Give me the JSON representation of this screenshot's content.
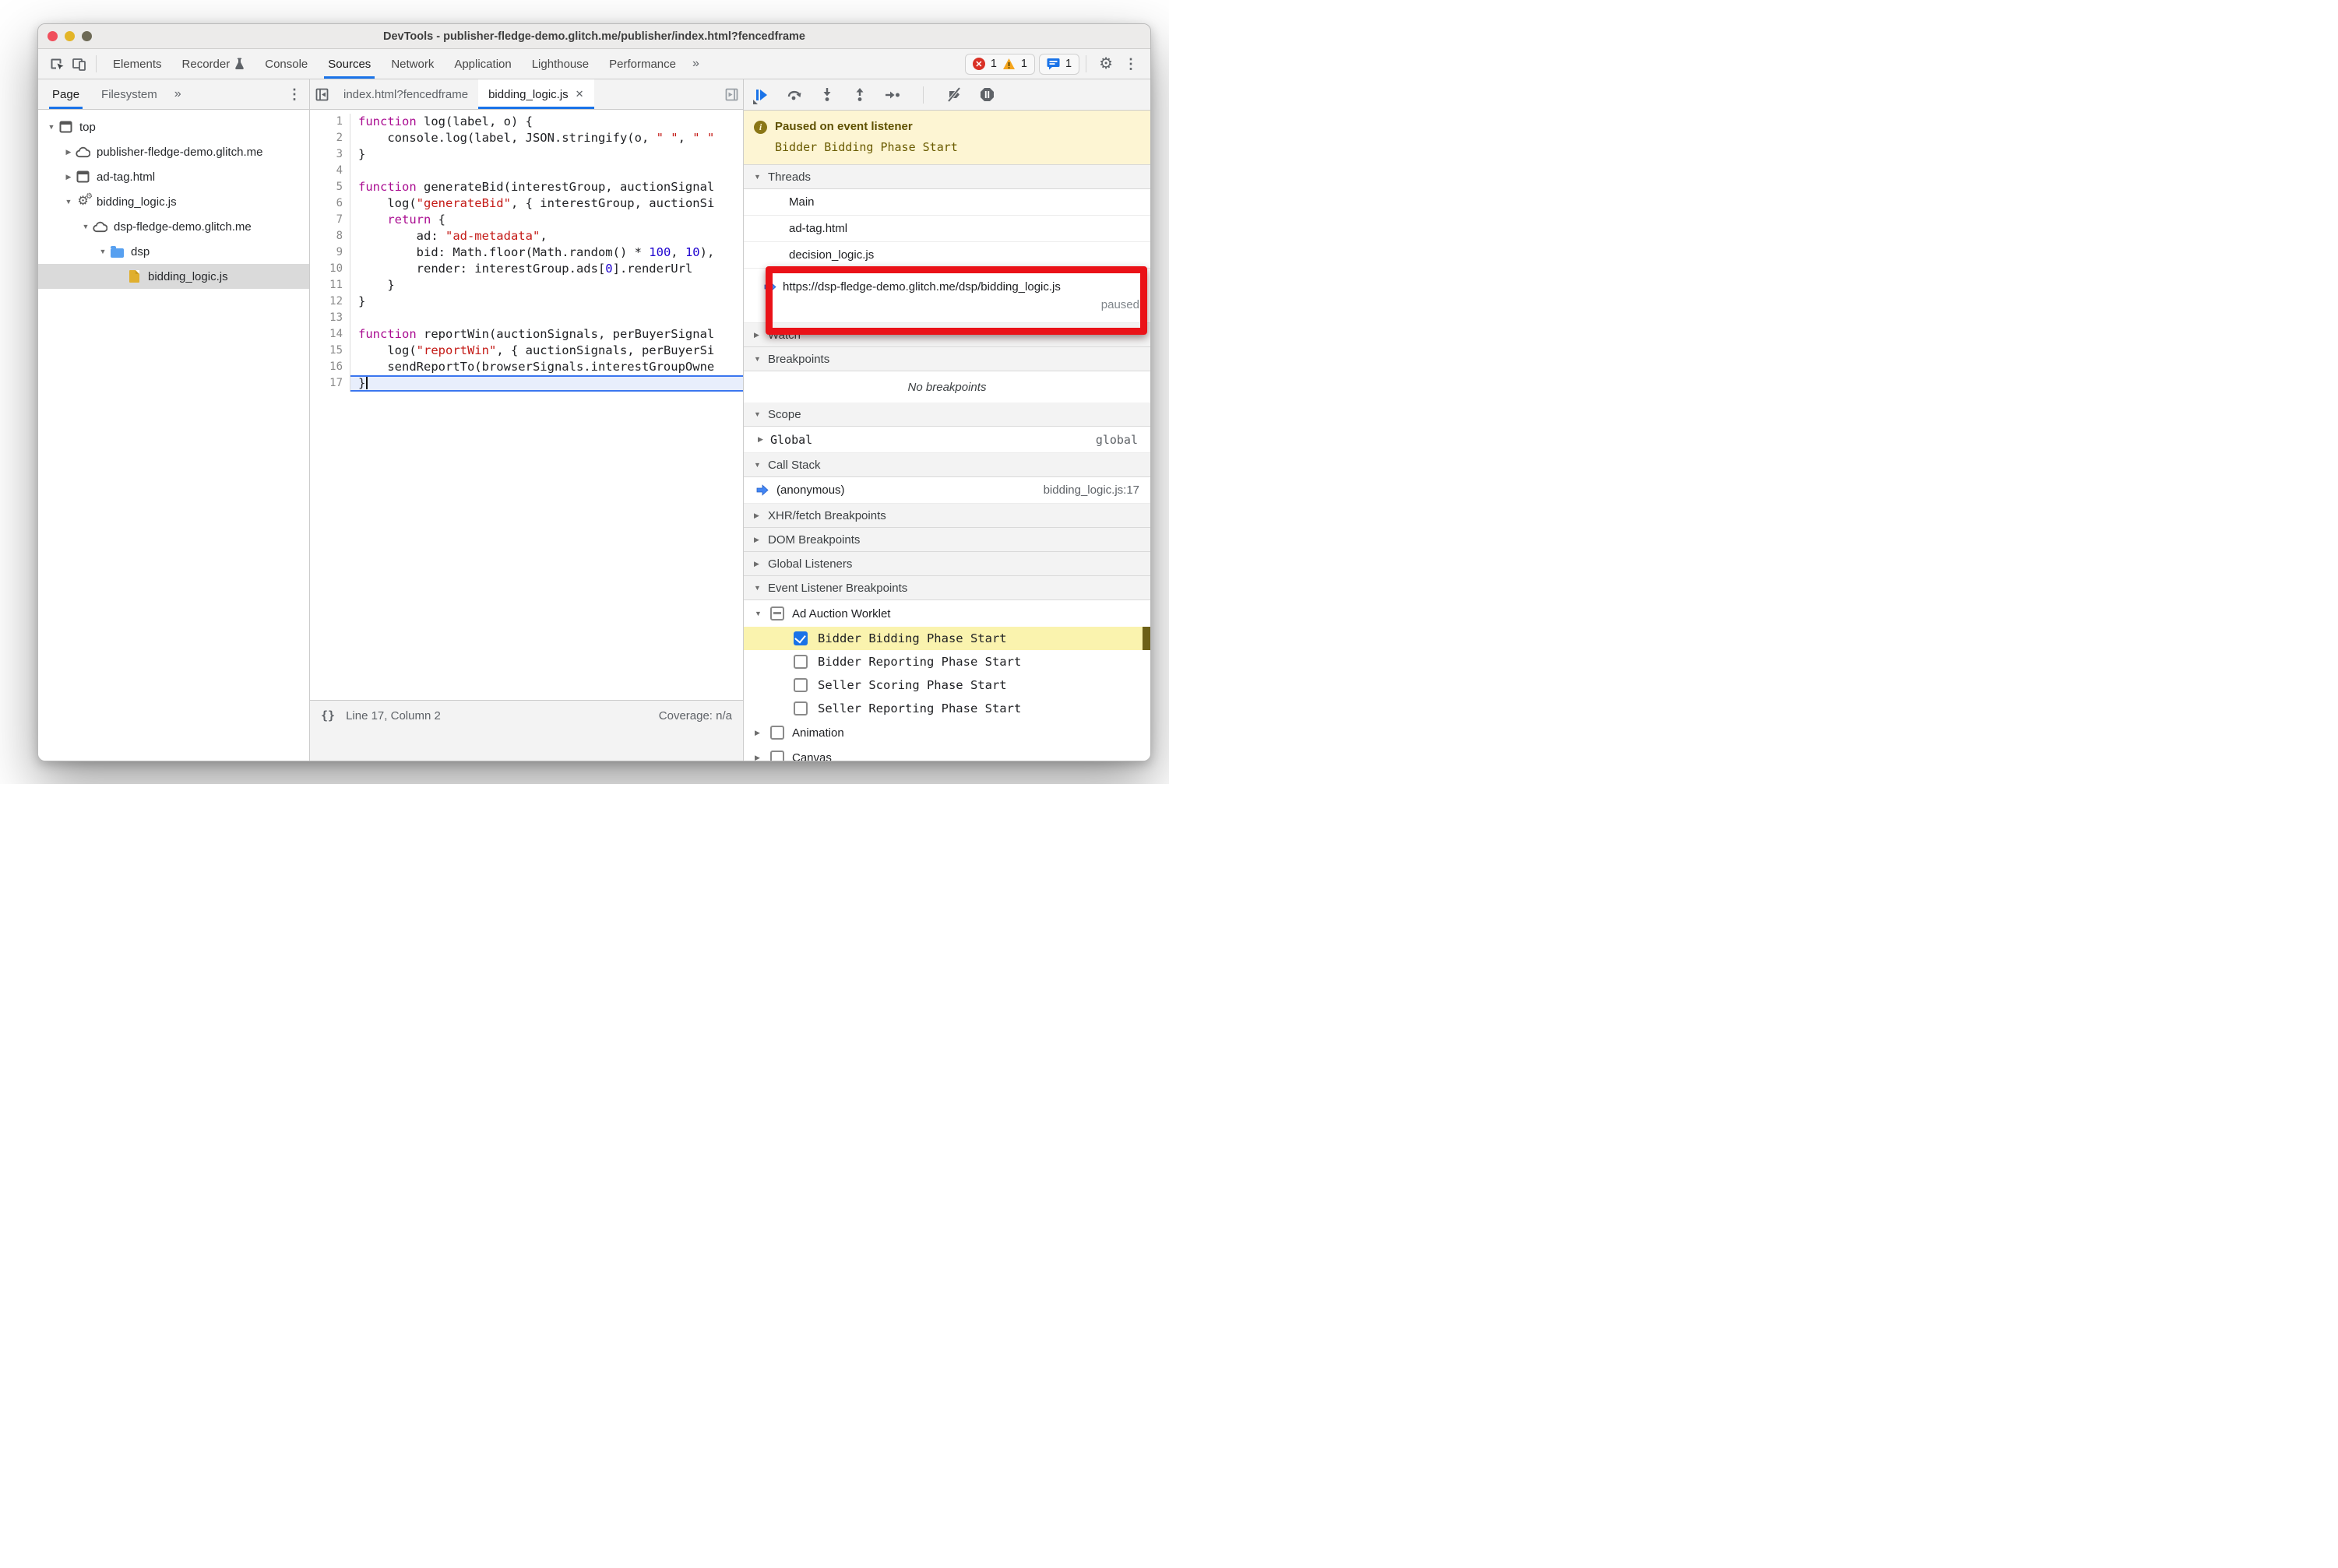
{
  "window": {
    "title": "DevTools - publisher-fledge-demo.glitch.me/publisher/index.html?fencedframe"
  },
  "main_tabs": {
    "items": [
      {
        "label": "Elements"
      },
      {
        "label": "Recorder",
        "icon": "flask"
      },
      {
        "label": "Console"
      },
      {
        "label": "Sources",
        "active": true
      },
      {
        "label": "Network"
      },
      {
        "label": "Application"
      },
      {
        "label": "Lighthouse"
      },
      {
        "label": "Performance"
      }
    ],
    "overflow": "»",
    "badges": {
      "errors": "1",
      "warnings": "1",
      "messages": "1"
    }
  },
  "sidebar": {
    "page_tab": "Page",
    "filesystem_tab": "Filesystem",
    "overflow": "»",
    "tree": [
      {
        "depth": 0,
        "expand": "open",
        "icon": "frame",
        "label": "top"
      },
      {
        "depth": 1,
        "expand": "closed",
        "icon": "cloud",
        "label": "publisher-fledge-demo.glitch.me"
      },
      {
        "depth": 1,
        "expand": "closed",
        "icon": "frame",
        "label": "ad-tag.html"
      },
      {
        "depth": 1,
        "expand": "open",
        "icon": "worklet",
        "label": "bidding_logic.js"
      },
      {
        "depth": 2,
        "expand": "open",
        "icon": "cloud",
        "label": "dsp-fledge-demo.glitch.me"
      },
      {
        "depth": 3,
        "expand": "open",
        "icon": "folder",
        "label": "dsp"
      },
      {
        "depth": 4,
        "expand": "none",
        "icon": "file",
        "label": "bidding_logic.js",
        "selected": true
      }
    ]
  },
  "editor": {
    "tabs": [
      {
        "label": "index.html?fencedframe",
        "active": false
      },
      {
        "label": "bidding_logic.js",
        "active": true,
        "close": "✕"
      }
    ],
    "code": [
      {
        "n": 1,
        "tokens": [
          [
            "k",
            "function"
          ],
          [
            "p",
            " log(label, o) {"
          ]
        ]
      },
      {
        "n": 2,
        "tokens": [
          [
            "p",
            "    console.log(label, JSON.stringify(o, "
          ],
          [
            "s",
            "\" \""
          ],
          [
            "p",
            ", "
          ],
          [
            "s",
            "\" \""
          ]
        ]
      },
      {
        "n": 3,
        "tokens": [
          [
            "p",
            "}"
          ]
        ]
      },
      {
        "n": 4,
        "tokens": []
      },
      {
        "n": 5,
        "tokens": [
          [
            "k",
            "function"
          ],
          [
            "p",
            " generateBid(interestGroup, auctionSignal"
          ]
        ]
      },
      {
        "n": 6,
        "tokens": [
          [
            "p",
            "    log("
          ],
          [
            "s",
            "\"generateBid\""
          ],
          [
            "p",
            ", { interestGroup, auctionSi"
          ]
        ]
      },
      {
        "n": 7,
        "tokens": [
          [
            "p",
            "    "
          ],
          [
            "k",
            "return"
          ],
          [
            "p",
            " {"
          ]
        ]
      },
      {
        "n": 8,
        "tokens": [
          [
            "p",
            "        ad: "
          ],
          [
            "s",
            "\"ad-metadata\""
          ],
          [
            "p",
            ","
          ]
        ]
      },
      {
        "n": 9,
        "tokens": [
          [
            "p",
            "        bid: Math.floor(Math.random() * "
          ],
          [
            "n",
            "100"
          ],
          [
            "p",
            ", "
          ],
          [
            "n",
            "10"
          ],
          [
            "p",
            "),"
          ]
        ]
      },
      {
        "n": 10,
        "tokens": [
          [
            "p",
            "        render: interestGroup.ads["
          ],
          [
            "n",
            "0"
          ],
          [
            "p",
            "].renderUrl"
          ]
        ]
      },
      {
        "n": 11,
        "tokens": [
          [
            "p",
            "    }"
          ]
        ]
      },
      {
        "n": 12,
        "tokens": [
          [
            "p",
            "}"
          ]
        ]
      },
      {
        "n": 13,
        "tokens": []
      },
      {
        "n": 14,
        "tokens": [
          [
            "k",
            "function"
          ],
          [
            "p",
            " reportWin(auctionSignals, perBuyerSignal"
          ]
        ]
      },
      {
        "n": 15,
        "tokens": [
          [
            "p",
            "    log("
          ],
          [
            "s",
            "\"reportWin\""
          ],
          [
            "p",
            ", { auctionSignals, perBuyerSi"
          ]
        ]
      },
      {
        "n": 16,
        "tokens": [
          [
            "p",
            "    sendReportTo(browserSignals.interestGroupOwne"
          ]
        ]
      },
      {
        "n": 17,
        "tokens": [
          [
            "p",
            "}"
          ]
        ],
        "highlight": true
      }
    ],
    "status": {
      "braces": "{}",
      "line_col": "Line 17, Column 2",
      "coverage": "Coverage: n/a"
    }
  },
  "debugger": {
    "paused_title": "Paused on event listener",
    "paused_detail": "Bidder Bidding Phase Start",
    "threads": {
      "title": "Threads",
      "items": [
        {
          "label": "Main"
        },
        {
          "label": "ad-tag.html"
        },
        {
          "label": "decision_logic.js"
        },
        {
          "label": "https://dsp-fledge-demo.glitch.me/dsp/bidding_logic.js",
          "active": true,
          "status": "paused"
        }
      ]
    },
    "watch": {
      "title": "Watch"
    },
    "breakpoints": {
      "title": "Breakpoints",
      "empty": "No breakpoints"
    },
    "scope": {
      "title": "Scope",
      "rows": [
        {
          "name": "Global",
          "value": "global"
        }
      ]
    },
    "call_stack": {
      "title": "Call Stack",
      "rows": [
        {
          "name": "(anonymous)",
          "location": "bidding_logic.js:17",
          "active": true
        }
      ]
    },
    "xhr_breakpoints": {
      "title": "XHR/fetch Breakpoints"
    },
    "dom_breakpoints": {
      "title": "DOM Breakpoints"
    },
    "global_listeners": {
      "title": "Global Listeners"
    },
    "event_listener_breakpoints": {
      "title": "Event Listener Breakpoints",
      "group": {
        "label": "Ad Auction Worklet",
        "state": "indeterminate",
        "expanded": true
      },
      "items": [
        {
          "label": "Bidder Bidding Phase Start",
          "checked": true,
          "highlight": true
        },
        {
          "label": "Bidder Reporting Phase Start",
          "checked": false
        },
        {
          "label": "Seller Scoring Phase Start",
          "checked": false
        },
        {
          "label": "Seller Reporting Phase Start",
          "checked": false
        }
      ],
      "extra": [
        {
          "label": "Animation"
        },
        {
          "label": "Canvas"
        }
      ]
    }
  },
  "colors": {
    "accent_blue": "#1a73e8",
    "execution_arrow_blue": "#4285f4",
    "error_red": "#d93025",
    "warning_yellow": "#f5a51d",
    "paused_banner_bg": "#fdf5d3",
    "paused_banner_text": "#6a5b00",
    "breakpoint_hit_row_yellow": "#faf3ae",
    "annotation_red": "#ea1218",
    "execution_line_blue": "#3b76ef",
    "syntax_keyword": "#aa0d91",
    "syntax_string": "#c41a16",
    "syntax_number": "#1c00cf"
  }
}
